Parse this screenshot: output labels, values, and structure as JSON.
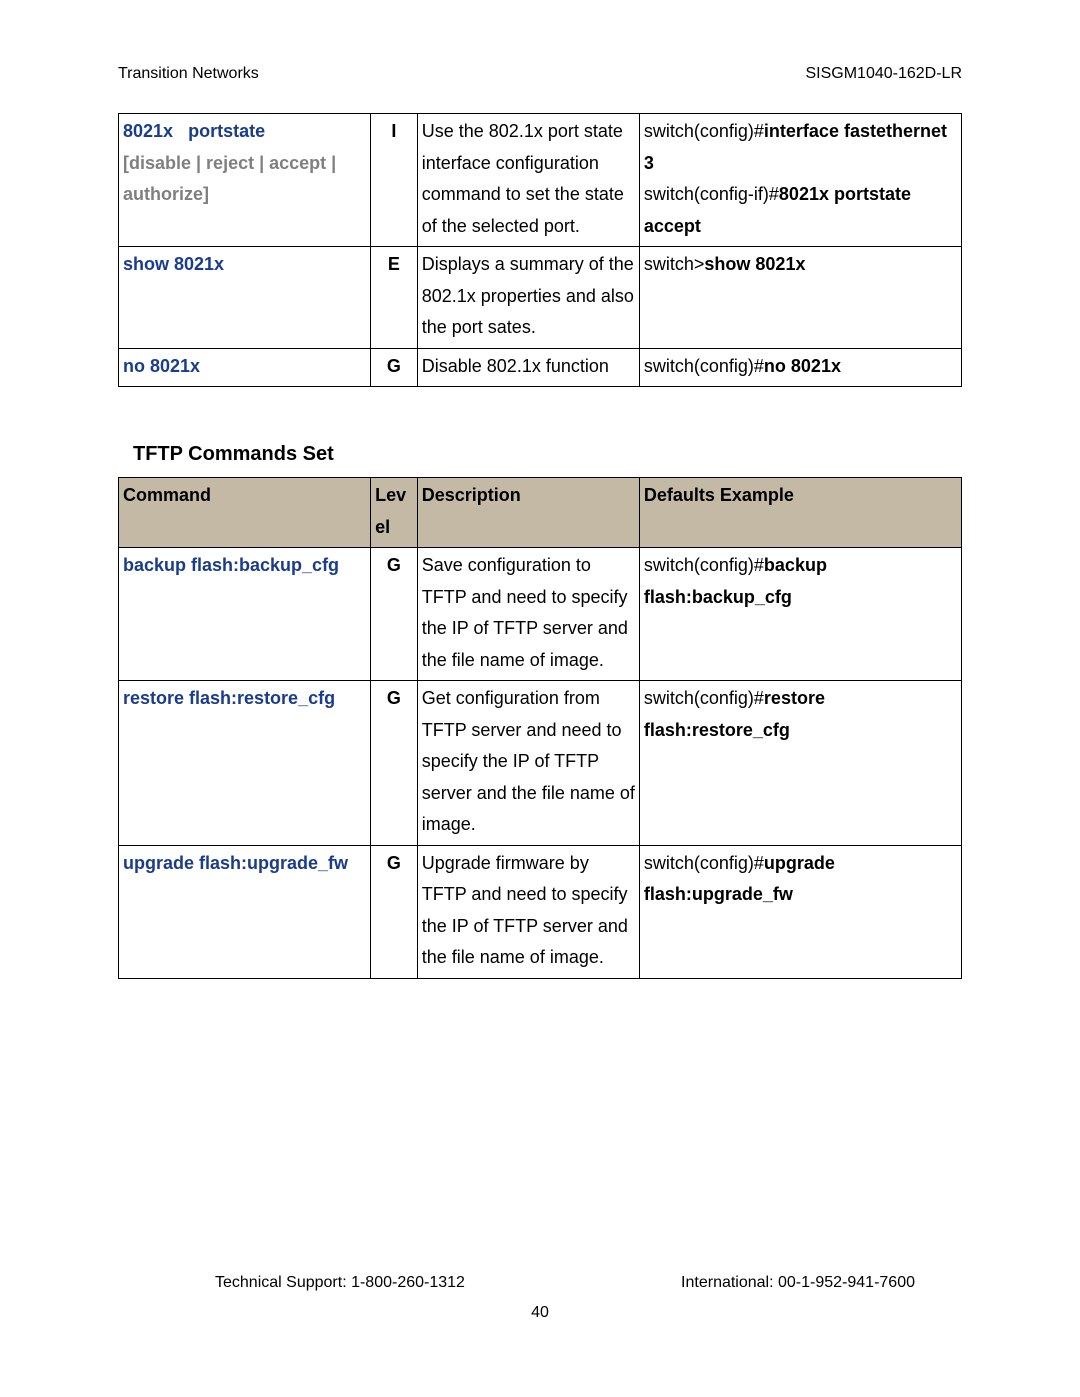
{
  "header": {
    "left": "Transition Networks",
    "right": "SISGM1040-162D-LR"
  },
  "table1": {
    "rows": [
      {
        "cmd_name": "8021x",
        "cmd_rest": "portstate",
        "cmd_params": "[disable | reject | accept | authorize]",
        "level": "I",
        "description": "Use the 802.1x port state interface configuration command to set the state of the selected port.",
        "example_plain1": "switch(config)#",
        "example_bold1": "interface fastethernet 3",
        "example_plain2": "switch(config-if)#",
        "example_bold2": "8021x portstate accept"
      },
      {
        "cmd_name": "show 8021x",
        "cmd_rest": "",
        "cmd_params": "",
        "level": "E",
        "description": "Displays a summary of the 802.1x properties and also the port sates.",
        "example_plain1": "switch>",
        "example_bold1": "show 8021x",
        "example_plain2": "",
        "example_bold2": ""
      },
      {
        "cmd_name": "no 8021x",
        "cmd_rest": "",
        "cmd_params": "",
        "level": "G",
        "description": "Disable 802.1x function",
        "example_plain1": "switch(config)#",
        "example_bold1": "no 8021x",
        "example_plain2": "",
        "example_bold2": ""
      }
    ]
  },
  "section_title": "TFTP Commands Set",
  "table2": {
    "head": {
      "command": "Command",
      "level": "Level",
      "description": "Description",
      "defaults": "Defaults Example"
    },
    "rows": [
      {
        "cmd_name": "backup flash:backup_cfg",
        "level": "G",
        "description": "Save configuration to TFTP and need to specify the IP of TFTP server and the file name of image.",
        "example_plain": "switch(config)#",
        "example_bold": "backup flash:backup_cfg"
      },
      {
        "cmd_name": "restore flash:restore_cfg",
        "level": "G",
        "description": "Get configuration from TFTP server and need to specify the IP of TFTP server and the file name of image.",
        "example_plain": "switch(config)#",
        "example_bold": "restore flash:restore_cfg"
      },
      {
        "cmd_name": "upgrade flash:upgrade_fw",
        "level": "G",
        "description": "Upgrade firmware by TFTP and need to specify the IP of TFTP server and the file name of image.",
        "example_plain": "switch(config)#",
        "example_bold": "upgrade flash:upgrade_fw"
      }
    ]
  },
  "footer": {
    "left": "Technical Support: 1-800-260-1312",
    "right": "International: 00-1-952-941-7600"
  },
  "page_number": "40"
}
